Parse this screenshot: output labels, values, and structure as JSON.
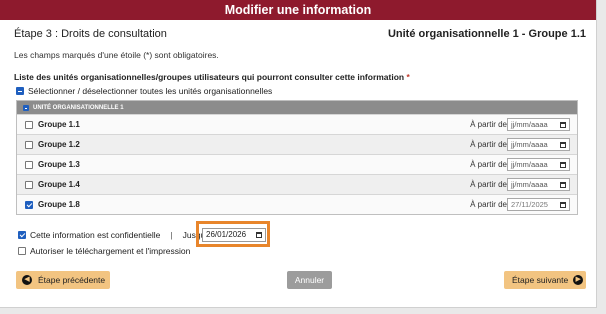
{
  "dialog": {
    "title": "Modifier une information"
  },
  "step": {
    "title": "Étape 3 : Droits de consultation",
    "current_group": "Unité organisationnelle 1 - Groupe 1.1"
  },
  "mandatory_note": "Les champs marqués d'une étoile (*) sont obligatoires.",
  "list": {
    "title": "Liste des unités organisationnelles/groupes utilisateurs qui pourront consulter cette information",
    "required_mark": "*",
    "select_all_label": "Sélectionner / déselectionner toutes les unités organisationnelles",
    "unit_header": "UNITÉ ORGANISATIONNELLE 1",
    "from_label": "À partir de",
    "rows": [
      {
        "label": "Groupe 1.1",
        "checked": false,
        "date": "jj/mm/aaaa"
      },
      {
        "label": "Groupe 1.2",
        "checked": false,
        "date": "jj/mm/aaaa"
      },
      {
        "label": "Groupe 1.3",
        "checked": false,
        "date": "jj/mm/aaaa"
      },
      {
        "label": "Groupe 1.4",
        "checked": false,
        "date": "jj/mm/aaaa"
      },
      {
        "label": "Groupe 1.8",
        "checked": true,
        "date": "27/11/2025"
      }
    ]
  },
  "confidential": {
    "label": "Cette information est confidentielle",
    "separator": "|",
    "until_label": "Jusqu'au",
    "required_mark": "*",
    "until_value": "26/01/2026",
    "checked": true
  },
  "download": {
    "label": "Autoriser le téléchargement et l'impression",
    "checked": false
  },
  "buttons": {
    "prev": "Étape précédente",
    "cancel": "Annuler",
    "next": "Étape suivante"
  },
  "colors": {
    "title_bar": "#8e1a2d",
    "step_button": "#f2c481",
    "cancel_button": "#9c9c9c",
    "checkbox": "#1f5fbf",
    "highlight": "#e8852b"
  }
}
